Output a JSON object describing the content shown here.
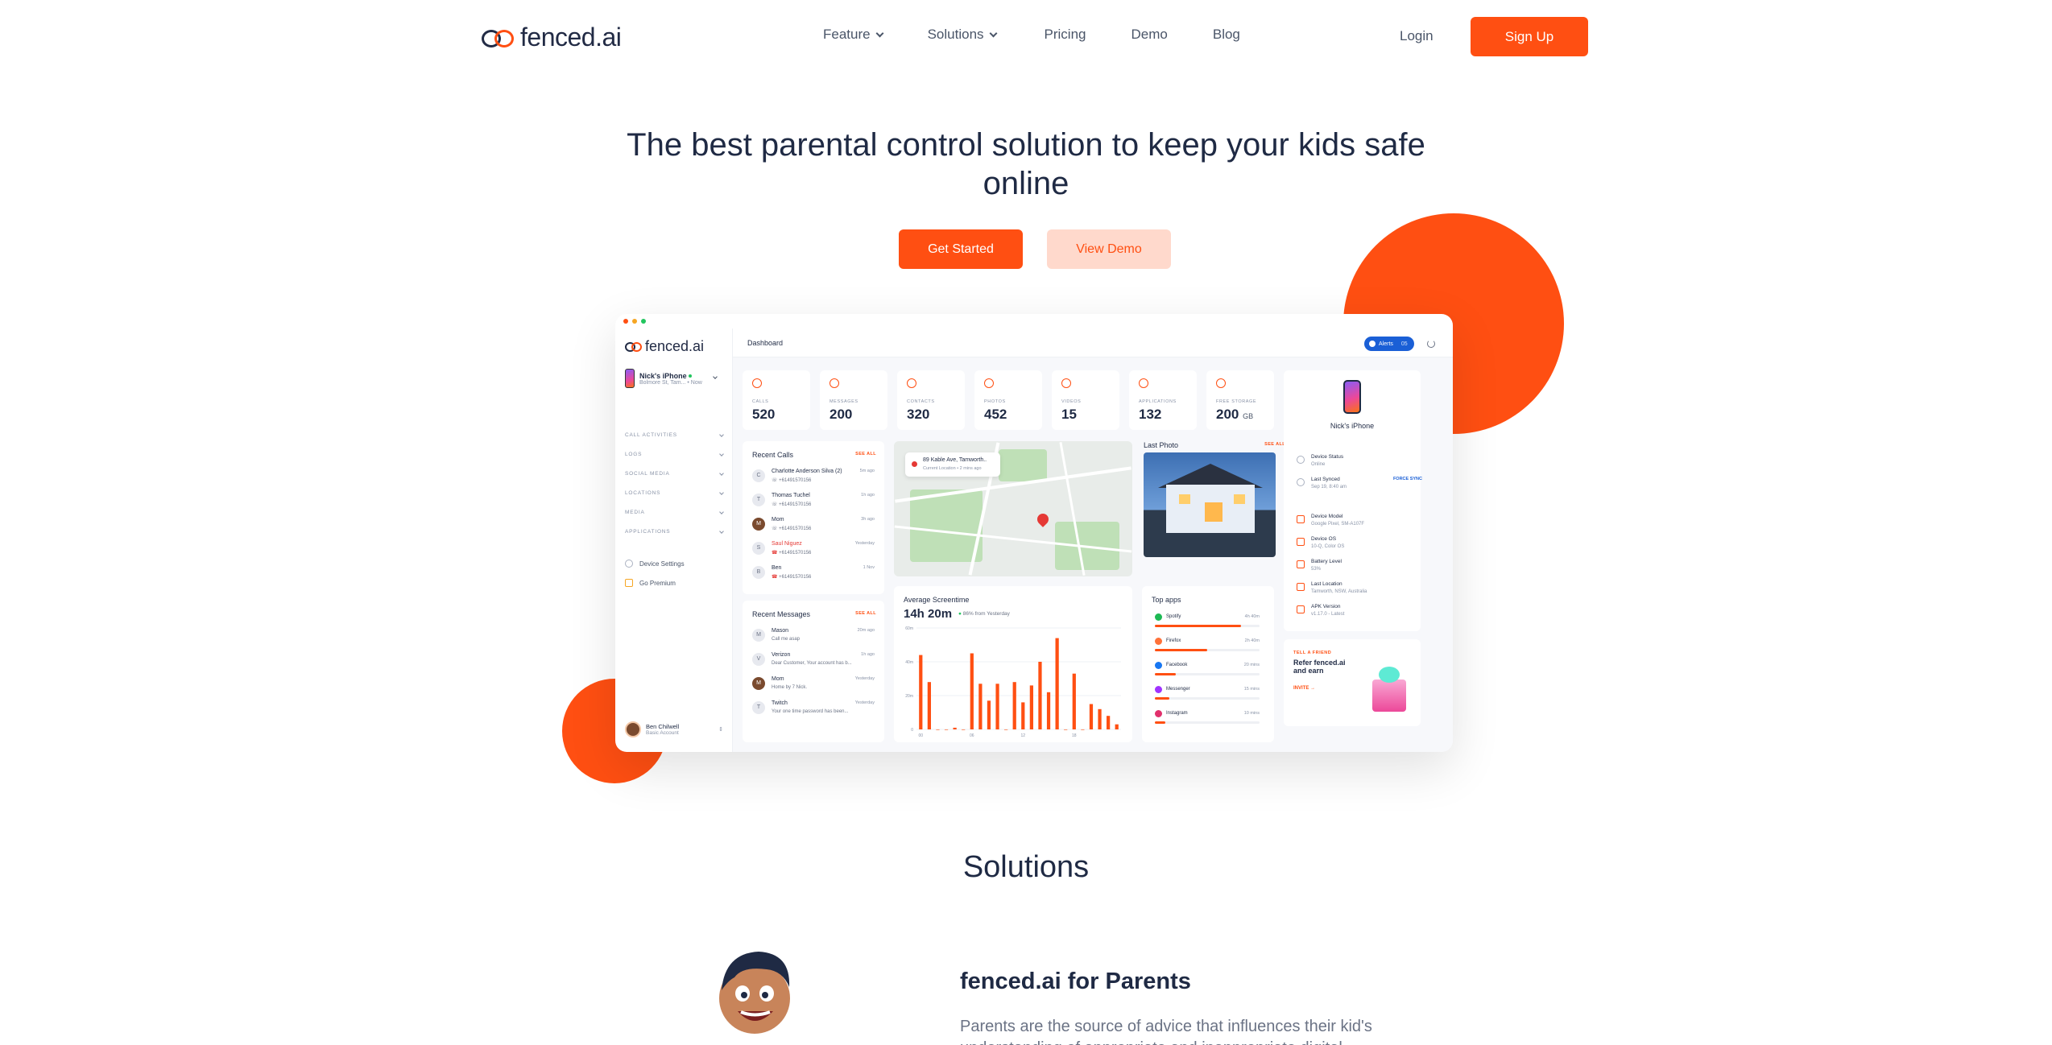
{
  "brand": {
    "name_pre": "fenced",
    "name_post": ".ai",
    "accent": "#ff4f12"
  },
  "nav": {
    "items": [
      {
        "label": "Feature",
        "dropdown": true
      },
      {
        "label": "Solutions",
        "dropdown": true
      },
      {
        "label": "Pricing",
        "dropdown": false
      },
      {
        "label": "Demo",
        "dropdown": false
      },
      {
        "label": "Blog",
        "dropdown": false
      }
    ],
    "login": "Login",
    "signup": "Sign Up"
  },
  "hero": {
    "title": "The best parental control solution to keep your kids safe online",
    "cta_primary": "Get Started",
    "cta_secondary": "View Demo"
  },
  "dashboard": {
    "sidebar": {
      "device_name": "Nick's iPhone",
      "device_sub": "Bolmore St, Tam... • Now",
      "menu": [
        "CALL ACTIVITIES",
        "LOGS",
        "SOCIAL MEDIA",
        "LOCATIONS",
        "MEDIA",
        "APPLICATIONS"
      ],
      "links": [
        "Device Settings",
        "Go Premium"
      ],
      "user_name": "Ben Chilwell",
      "user_plan": "Basic Account"
    },
    "topbar": {
      "title": "Dashboard",
      "alerts": "Alerts",
      "alerts_count": "05"
    },
    "stats": [
      {
        "label": "CALLS",
        "value": "520",
        "unit": ""
      },
      {
        "label": "MESSAGES",
        "value": "200",
        "unit": ""
      },
      {
        "label": "CONTACTS",
        "value": "320",
        "unit": ""
      },
      {
        "label": "PHOTOS",
        "value": "452",
        "unit": ""
      },
      {
        "label": "VIDEOS",
        "value": "15",
        "unit": ""
      },
      {
        "label": "APPLICATIONS",
        "value": "132",
        "unit": ""
      },
      {
        "label": "FREE STORAGE",
        "value": "200",
        "unit": "GB"
      }
    ],
    "recent_calls": {
      "title": "Recent Calls",
      "see_all": "SEE ALL",
      "items": [
        {
          "initial": "C",
          "name": "Charlotte Anderson Silva (2)",
          "number": "+61491570156",
          "time": "5m ago",
          "missed": false
        },
        {
          "initial": "T",
          "name": "Thomas Tuchel",
          "number": "+61491570156",
          "time": "1h ago",
          "missed": false
        },
        {
          "initial": "M",
          "name": "Mom",
          "number": "+61491570156",
          "time": "3h ago",
          "missed": false
        },
        {
          "initial": "S",
          "name": "Saul Niguez",
          "number": "+61491570156",
          "time": "Yesterday",
          "missed": true
        },
        {
          "initial": "B",
          "name": "Ben",
          "number": "+61491570156",
          "time": "1 Nov",
          "missed": false
        }
      ]
    },
    "recent_messages": {
      "title": "Recent Messages",
      "see_all": "SEE ALL",
      "items": [
        {
          "initial": "M",
          "name": "Mason",
          "text": "Call me asap",
          "time": "20m ago"
        },
        {
          "initial": "V",
          "name": "Verizon",
          "text": "Dear Customer, Your account has b...",
          "time": "1h ago"
        },
        {
          "initial": "M",
          "name": "Mom",
          "text": "Home by 7 Nick.",
          "time": "Yesterday"
        },
        {
          "initial": "T",
          "name": "Twitch",
          "text": "Your one time password has been...",
          "time": "Yesterday"
        }
      ]
    },
    "map": {
      "address": "89 Kable Ave, Tamworth..",
      "sub": "Current Location • 2 mins ago"
    },
    "last_photo": {
      "title": "Last Photo",
      "see_all": "SEE ALL"
    },
    "screentime": {
      "title": "Average Screentime",
      "value": "14h 20m",
      "delta": "86% from Yesterday"
    },
    "top_apps": {
      "title": "Top apps",
      "items": [
        {
          "name": "Spotify",
          "time": "4h 40m",
          "fill": 0.82,
          "color": "#1db954"
        },
        {
          "name": "Firefox",
          "time": "2h 40m",
          "fill": 0.5,
          "color": "#ff7139"
        },
        {
          "name": "Facebook",
          "time": "20 mins",
          "fill": 0.2,
          "color": "#1877f2"
        },
        {
          "name": "Messenger",
          "time": "15 mins",
          "fill": 0.14,
          "color": "#a033ff"
        },
        {
          "name": "Instagram",
          "time": "10 mins",
          "fill": 0.1,
          "color": "#e1306c"
        }
      ]
    },
    "device": {
      "name": "Nick's iPhone",
      "force_sync": "FORCE SYNC",
      "info": [
        {
          "key": "Device Status",
          "value": "Online"
        },
        {
          "key": "Last Synced",
          "value": "Sep 19, 8:40 am"
        },
        {
          "key": "Device Model",
          "value": "Google Pixel, SM-A107F"
        },
        {
          "key": "Device OS",
          "value": "10-Q, Color OS"
        },
        {
          "key": "Battery Level",
          "value": "53%"
        },
        {
          "key": "Last Location",
          "value": "Tamworth, NSW, Australia"
        },
        {
          "key": "APK Version",
          "value": "v1.17.0 - Latest"
        }
      ]
    },
    "refer": {
      "eyebrow": "TELL A FRIEND",
      "title": "Refer fenced.ai and earn",
      "cta": "INVITE"
    }
  },
  "chart_data": {
    "type": "bar",
    "title": "Average Screentime",
    "categories": [
      "00",
      "01",
      "02",
      "03",
      "04",
      "05",
      "06",
      "07",
      "08",
      "09",
      "10",
      "11",
      "12",
      "13",
      "14",
      "15",
      "16",
      "17",
      "18",
      "19",
      "20",
      "21",
      "22",
      "23"
    ],
    "values": [
      44,
      28,
      0,
      0,
      1,
      0,
      45,
      27,
      17,
      27,
      0,
      28,
      16,
      26,
      40,
      22,
      54,
      0,
      33,
      0,
      15,
      12,
      8,
      3
    ],
    "xticks": [
      "00",
      "06",
      "12",
      "18"
    ],
    "yticks": [
      "0",
      "20m",
      "40m",
      "60m"
    ],
    "ylim": [
      0,
      60
    ]
  },
  "solutions": {
    "title": "Solutions",
    "parents_title": "fenced.ai for Parents",
    "parents_text": "Parents are the source of advice that influences their kid's understanding of appropriate and inappropriate digital"
  }
}
